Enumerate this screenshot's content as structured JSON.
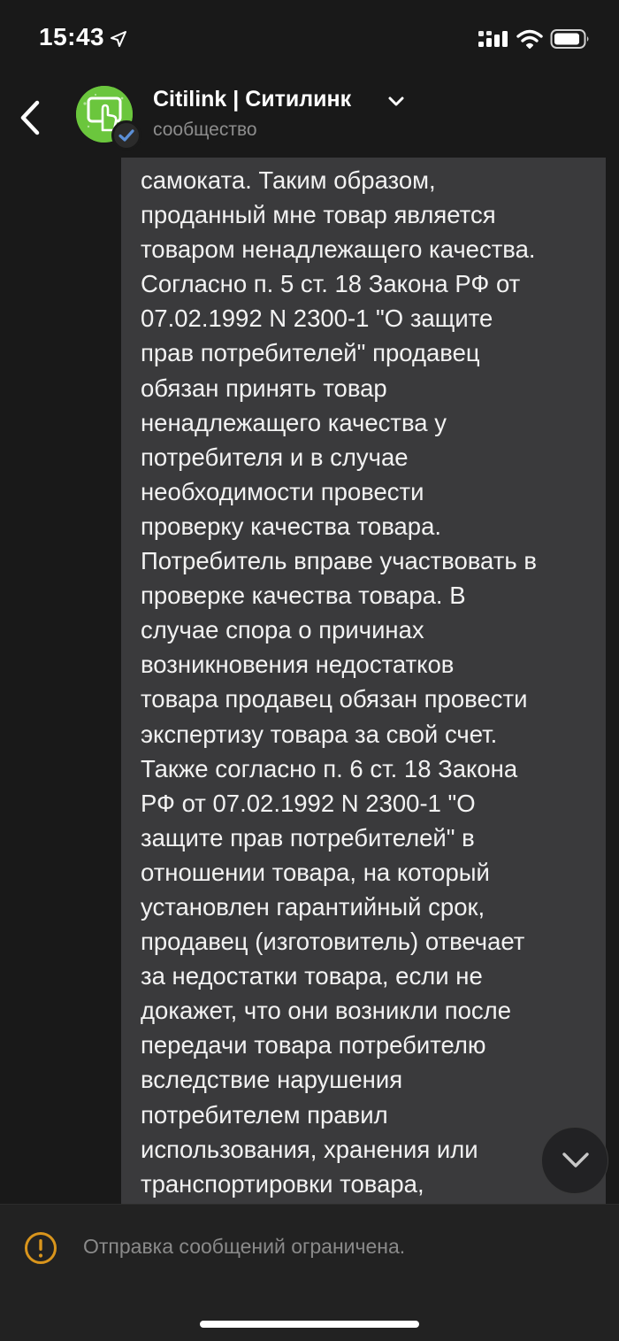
{
  "status_bar": {
    "time": "15:43",
    "location_icon": "location-arrow-icon",
    "signal_icon": "cellular-signal-icon",
    "wifi_icon": "wifi-icon",
    "battery_icon": "battery-icon"
  },
  "header": {
    "back_icon": "chevron-left-icon",
    "title": "Citilink | Ситилинк",
    "subtitle": "сообщество",
    "avatar_color": "#6bc63d",
    "verified_badge_color": "#5b8fd6"
  },
  "message": {
    "text": "самоката. Таким образом,\nпроданный мне товар является\nтоваром ненадлежащего качества.\nСогласно п. 5 ст. 18 Закона РФ от\n07.02.1992 N 2300-1 \"О защите\nправ потребителей\" продавец\nобязан принять товар\nненадлежащего качества у\nпотребителя и в случае\nнеобходимости провести\nпроверку качества товара.\nПотребитель вправе участвовать в\nпроверке качества товара. В\nслучае спора о причинах\nвозникновения недостатков\nтовара продавец обязан провести\nэкспертизу товара за свой счет.\nТакже согласно п. 6 ст. 18 Закона\nРФ от 07.02.1992 N 2300-1 \"О\nзащите прав потребителей\" в\nотношении товара, на который\nустановлен гарантийный срок,\nпродавец (изготовитель) отвечает\nза недостатки товара, если не\nдокажет, что они возникли после\nпередачи товара потребителю\nвследствие нарушения\nпотребителем правил\nиспользования, хранения или\nтранспортировки товара,",
    "bubble_color": "#3a3a3c"
  },
  "scroll_down": {
    "icon": "chevron-down-icon"
  },
  "bottom_bar": {
    "warning_icon": "exclamation-circle-icon",
    "warning_color": "#d9951c",
    "text": "Отправка сообщений ограничена."
  }
}
